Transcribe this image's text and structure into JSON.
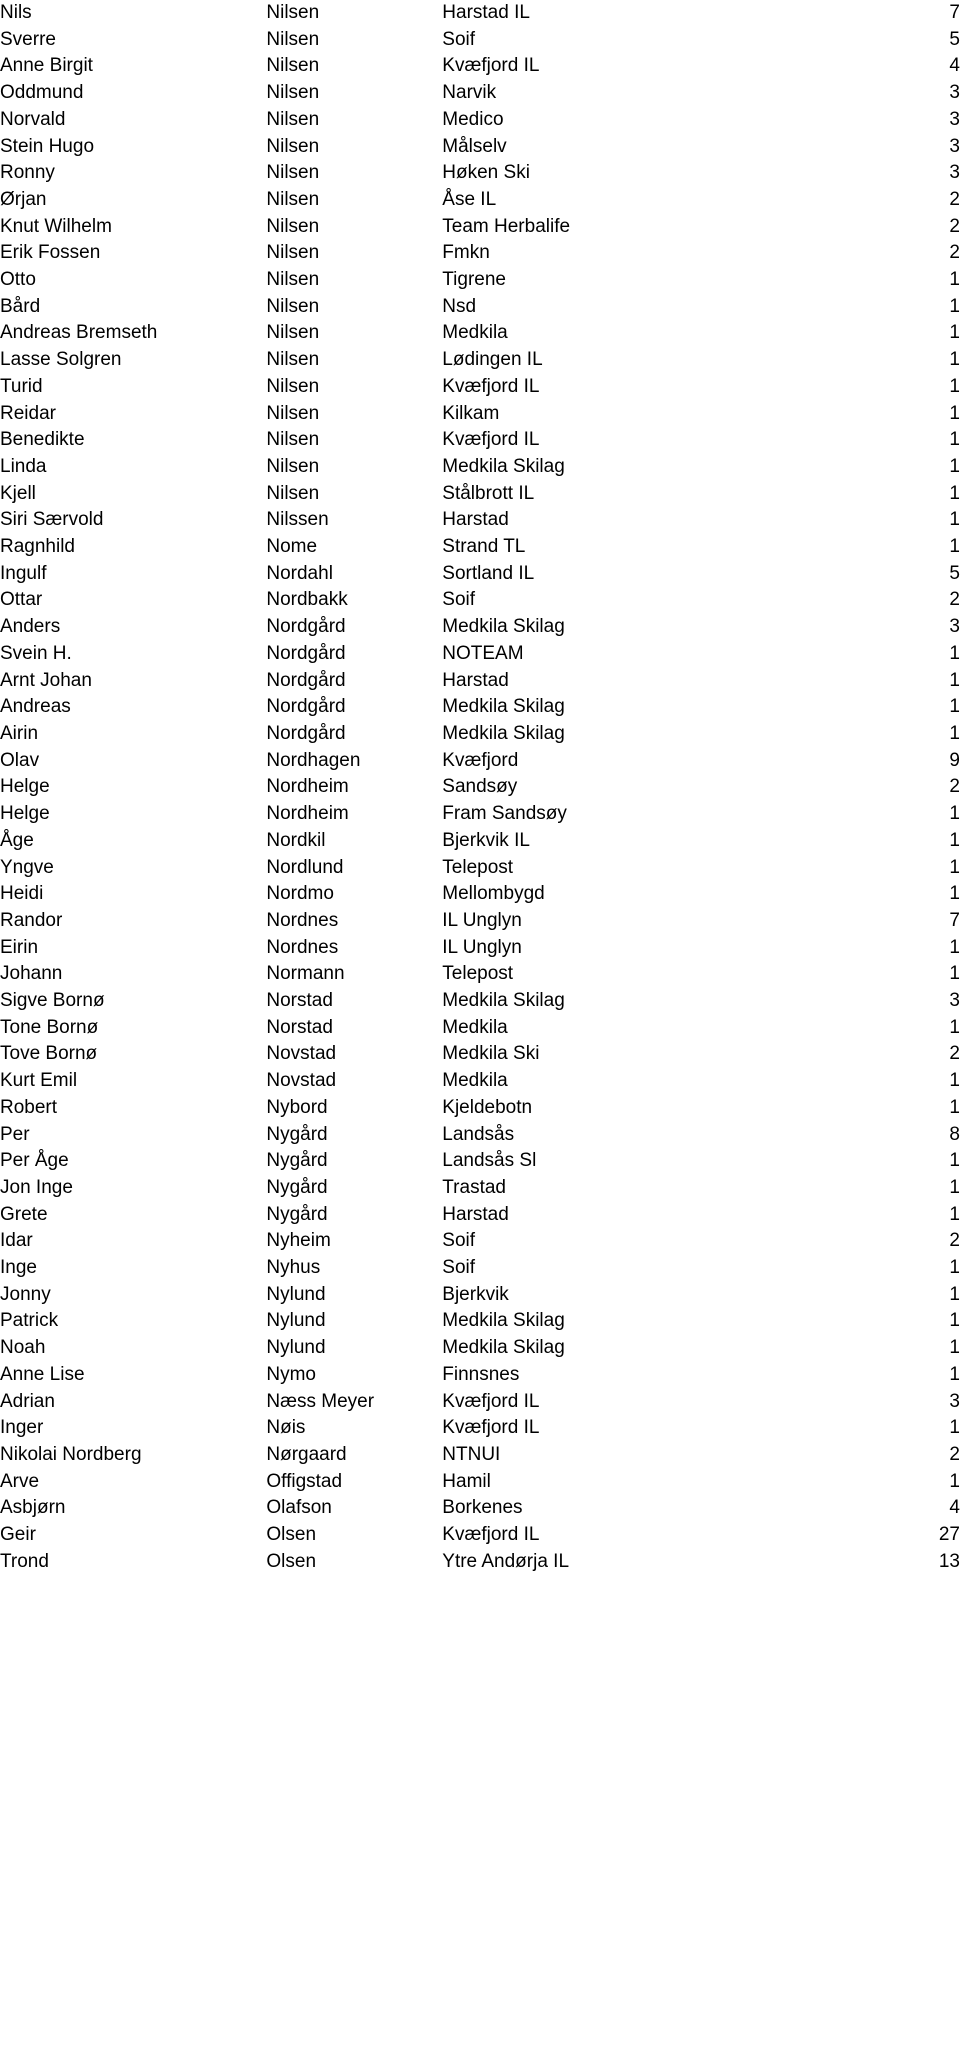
{
  "document": {
    "type": "name-frequency-table",
    "columns": [
      "first_name",
      "last_name",
      "club",
      "count"
    ],
    "rows": [
      {
        "first_name": "Nils",
        "last_name": "Nilsen",
        "club": "Harstad IL",
        "count": "7"
      },
      {
        "first_name": "Sverre",
        "last_name": "Nilsen",
        "club": "Soif",
        "count": "5"
      },
      {
        "first_name": "Anne Birgit",
        "last_name": "Nilsen",
        "club": "Kvæfjord IL",
        "count": "4"
      },
      {
        "first_name": "Oddmund",
        "last_name": "Nilsen",
        "club": "Narvik",
        "count": "3"
      },
      {
        "first_name": "Norvald",
        "last_name": "Nilsen",
        "club": "Medico",
        "count": "3"
      },
      {
        "first_name": "Stein Hugo",
        "last_name": "Nilsen",
        "club": "Målselv",
        "count": "3"
      },
      {
        "first_name": "Ronny",
        "last_name": "Nilsen",
        "club": "Høken Ski",
        "count": "3"
      },
      {
        "first_name": "Ørjan",
        "last_name": "Nilsen",
        "club": "Åse IL",
        "count": "2"
      },
      {
        "first_name": "Knut Wilhelm",
        "last_name": "Nilsen",
        "club": "Team Herbalife",
        "count": "2"
      },
      {
        "first_name": "Erik Fossen",
        "last_name": "Nilsen",
        "club": "Fmkn",
        "count": "2"
      },
      {
        "first_name": "Otto",
        "last_name": "Nilsen",
        "club": "Tigrene",
        "count": "1"
      },
      {
        "first_name": "Bård",
        "last_name": "Nilsen",
        "club": "Nsd",
        "count": "1"
      },
      {
        "first_name": "Andreas Bremseth",
        "last_name": "Nilsen",
        "club": "Medkila",
        "count": "1"
      },
      {
        "first_name": "Lasse Solgren",
        "last_name": "Nilsen",
        "club": "Lødingen IL",
        "count": "1"
      },
      {
        "first_name": "Turid",
        "last_name": "Nilsen",
        "club": "Kvæfjord IL",
        "count": "1"
      },
      {
        "first_name": "Reidar",
        "last_name": "Nilsen",
        "club": "Kilkam",
        "count": "1"
      },
      {
        "first_name": "Benedikte",
        "last_name": "Nilsen",
        "club": "Kvæfjord IL",
        "count": "1"
      },
      {
        "first_name": "Linda",
        "last_name": "Nilsen",
        "club": "Medkila Skilag",
        "count": "1"
      },
      {
        "first_name": "Kjell",
        "last_name": "Nilsen",
        "club": "Stålbrott IL",
        "count": "1"
      },
      {
        "first_name": "Siri Særvold",
        "last_name": "Nilssen",
        "club": "Harstad",
        "count": "1"
      },
      {
        "first_name": "Ragnhild",
        "last_name": "Nome",
        "club": "Strand TL",
        "count": "1"
      },
      {
        "first_name": "Ingulf",
        "last_name": "Nordahl",
        "club": "Sortland IL",
        "count": "5"
      },
      {
        "first_name": "Ottar",
        "last_name": "Nordbakk",
        "club": "Soif",
        "count": "2"
      },
      {
        "first_name": "Anders",
        "last_name": "Nordgård",
        "club": "Medkila Skilag",
        "count": "3"
      },
      {
        "first_name": "Svein H.",
        "last_name": "Nordgård",
        "club": "NOTEAM",
        "count": "1"
      },
      {
        "first_name": "Arnt Johan",
        "last_name": "Nordgård",
        "club": "Harstad",
        "count": "1"
      },
      {
        "first_name": "Andreas",
        "last_name": "Nordgård",
        "club": "Medkila Skilag",
        "count": "1"
      },
      {
        "first_name": "Airin",
        "last_name": "Nordgård",
        "club": "Medkila Skilag",
        "count": "1"
      },
      {
        "first_name": "Olav",
        "last_name": "Nordhagen",
        "club": "Kvæfjord",
        "count": "9"
      },
      {
        "first_name": "Helge",
        "last_name": "Nordheim",
        "club": "Sandsøy",
        "count": "2"
      },
      {
        "first_name": "Helge",
        "last_name": "Nordheim",
        "club": "Fram Sandsøy",
        "count": "1"
      },
      {
        "first_name": "Åge",
        "last_name": "Nordkil",
        "club": "Bjerkvik IL",
        "count": "1"
      },
      {
        "first_name": "Yngve",
        "last_name": "Nordlund",
        "club": "Telepost",
        "count": "1"
      },
      {
        "first_name": "Heidi",
        "last_name": "Nordmo",
        "club": "Mellombygd",
        "count": "1"
      },
      {
        "first_name": "Randor",
        "last_name": "Nordnes",
        "club": "IL Unglyn",
        "count": "7"
      },
      {
        "first_name": "Eirin",
        "last_name": "Nordnes",
        "club": "IL Unglyn",
        "count": "1"
      },
      {
        "first_name": "Johann",
        "last_name": "Normann",
        "club": "Telepost",
        "count": "1"
      },
      {
        "first_name": "Sigve Bornø",
        "last_name": "Norstad",
        "club": "Medkila Skilag",
        "count": "3"
      },
      {
        "first_name": "Tone Bornø",
        "last_name": "Norstad",
        "club": "Medkila",
        "count": "1"
      },
      {
        "first_name": "Tove Bornø",
        "last_name": "Novstad",
        "club": "Medkila Ski",
        "count": "2"
      },
      {
        "first_name": "Kurt Emil",
        "last_name": "Novstad",
        "club": "Medkila",
        "count": "1"
      },
      {
        "first_name": "Robert",
        "last_name": "Nybord",
        "club": "Kjeldebotn",
        "count": "1"
      },
      {
        "first_name": "Per",
        "last_name": "Nygård",
        "club": "Landsås",
        "count": "8"
      },
      {
        "first_name": "Per Åge",
        "last_name": "Nygård",
        "club": "Landsås Sl",
        "count": "1"
      },
      {
        "first_name": "Jon Inge",
        "last_name": "Nygård",
        "club": "Trastad",
        "count": "1"
      },
      {
        "first_name": "Grete",
        "last_name": "Nygård",
        "club": "Harstad",
        "count": "1"
      },
      {
        "first_name": "Idar",
        "last_name": "Nyheim",
        "club": "Soif",
        "count": "2"
      },
      {
        "first_name": "Inge",
        "last_name": "Nyhus",
        "club": "Soif",
        "count": "1"
      },
      {
        "first_name": "Jonny",
        "last_name": "Nylund",
        "club": "Bjerkvik",
        "count": "1"
      },
      {
        "first_name": "Patrick",
        "last_name": "Nylund",
        "club": "Medkila Skilag",
        "count": "1"
      },
      {
        "first_name": "Noah",
        "last_name": "Nylund",
        "club": "Medkila Skilag",
        "count": "1"
      },
      {
        "first_name": "Anne Lise",
        "last_name": "Nymo",
        "club": "Finnsnes",
        "count": "1"
      },
      {
        "first_name": "Adrian",
        "last_name": "Næss Meyer",
        "club": "Kvæfjord IL",
        "count": "3"
      },
      {
        "first_name": "Inger",
        "last_name": "Nøis",
        "club": "Kvæfjord IL",
        "count": "1"
      },
      {
        "first_name": "Nikolai Nordberg",
        "last_name": "Nørgaard",
        "club": "NTNUI",
        "count": "2"
      },
      {
        "first_name": "Arve",
        "last_name": "Offigstad",
        "club": "Hamil",
        "count": "1"
      },
      {
        "first_name": "Asbjørn",
        "last_name": "Olafson",
        "club": "Borkenes",
        "count": "4"
      },
      {
        "first_name": "Geir",
        "last_name": "Olsen",
        "club": "Kvæfjord IL",
        "count": "27"
      },
      {
        "first_name": "Trond",
        "last_name": "Olsen",
        "club": "Ytre Andørja IL",
        "count": "13"
      }
    ]
  }
}
